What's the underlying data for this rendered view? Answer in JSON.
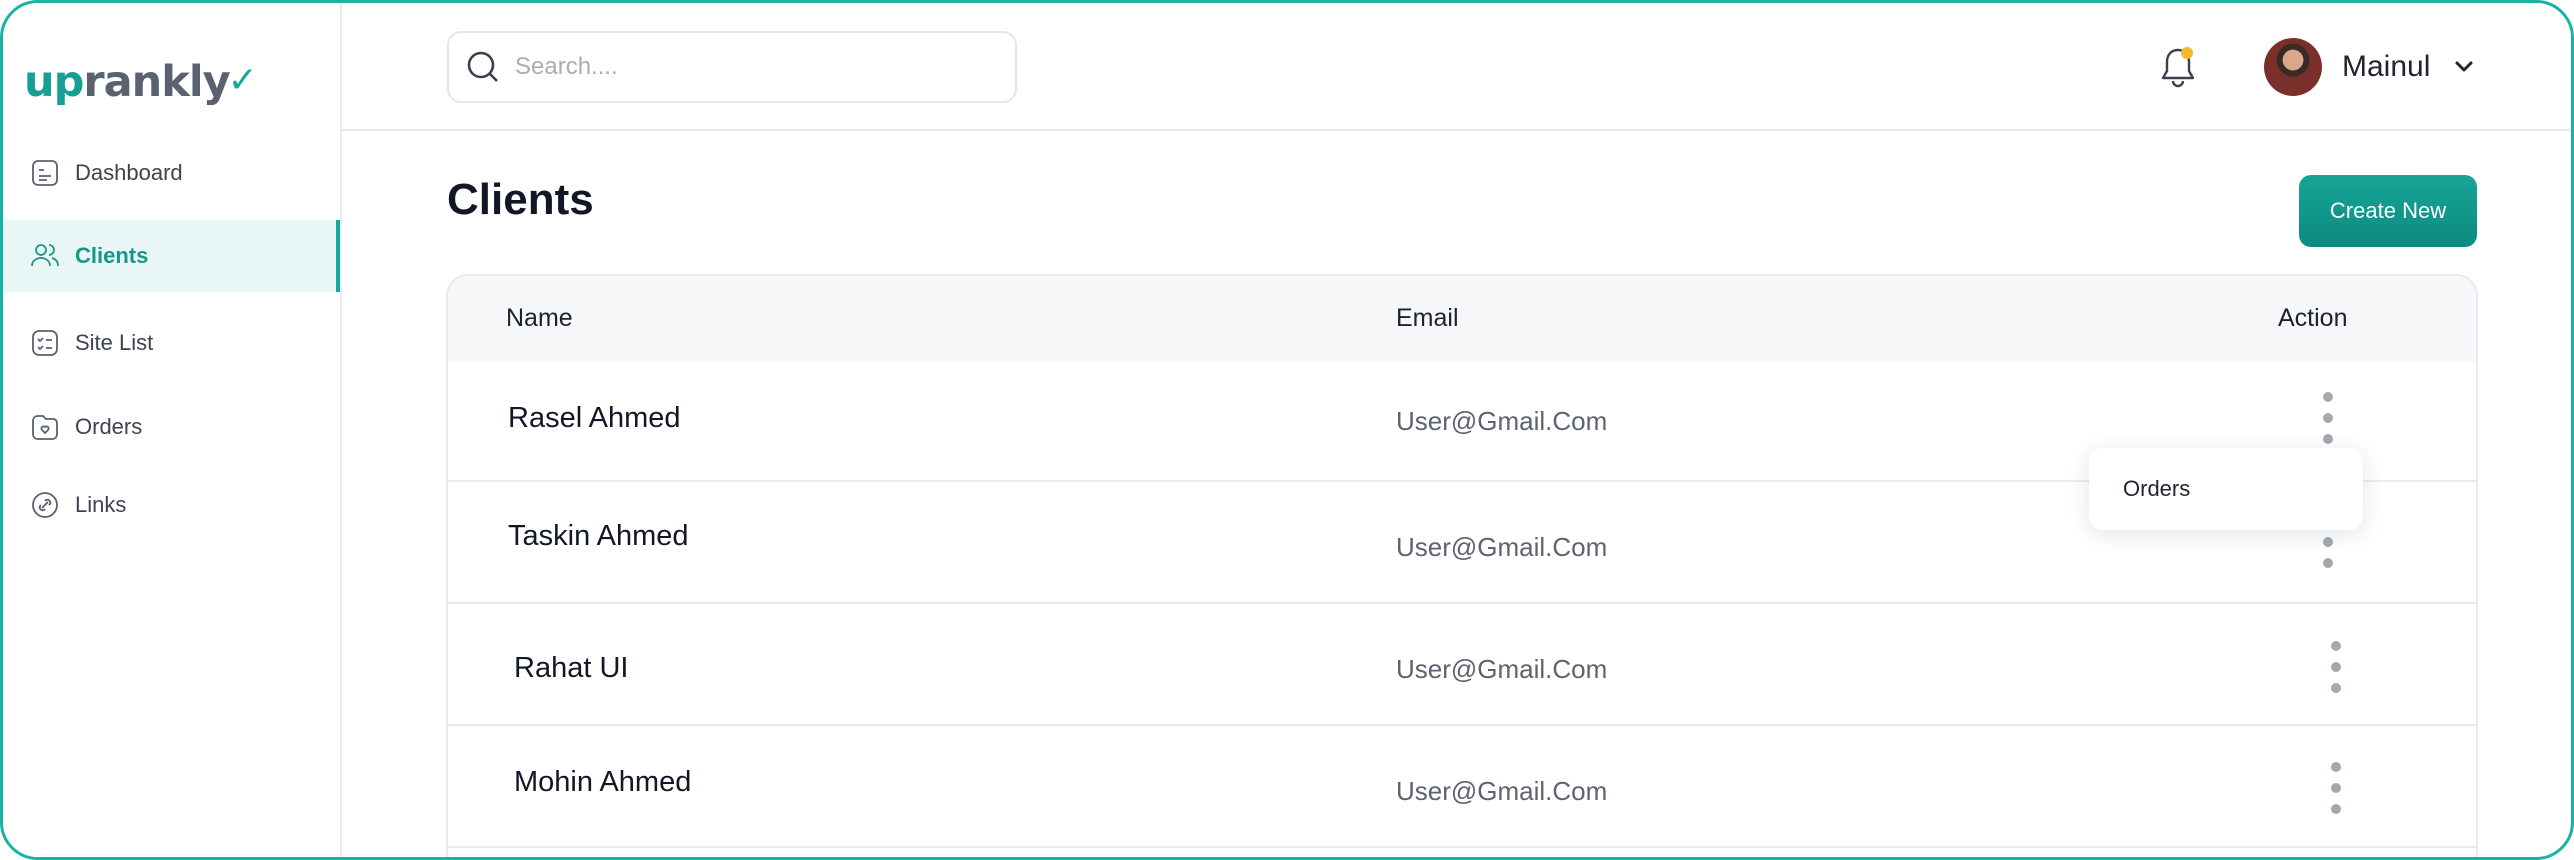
{
  "brand": {
    "logo_up": "up",
    "logo_rest": "rankly",
    "accent": "#16a89d"
  },
  "sidebar": {
    "items": [
      {
        "label": "Dashboard",
        "icon": "dashboard-icon",
        "active": false
      },
      {
        "label": "Clients",
        "icon": "users-icon",
        "active": true
      },
      {
        "label": "Site List",
        "icon": "checklist-icon",
        "active": false
      },
      {
        "label": "Orders",
        "icon": "folder-heart-icon",
        "active": false
      },
      {
        "label": "Links",
        "icon": "link-icon",
        "active": false
      }
    ]
  },
  "header": {
    "search_placeholder": "Search....",
    "notification_badge_color": "#f5b82e",
    "user_name": "Mainul"
  },
  "main": {
    "title": "Clients",
    "create_button": "Create New",
    "table": {
      "columns": [
        "Name",
        "Email",
        "Action"
      ],
      "rows": [
        {
          "name": "Rasel Ahmed",
          "email": "User@Gmail.Com"
        },
        {
          "name": "Taskin Ahmed",
          "email": "User@Gmail.Com"
        },
        {
          "name": "Rahat UI",
          "email": "User@Gmail.Com"
        },
        {
          "name": "Mohin Ahmed",
          "email": "User@Gmail.Com"
        }
      ]
    },
    "action_menu": {
      "items": [
        "Orders"
      ]
    }
  }
}
